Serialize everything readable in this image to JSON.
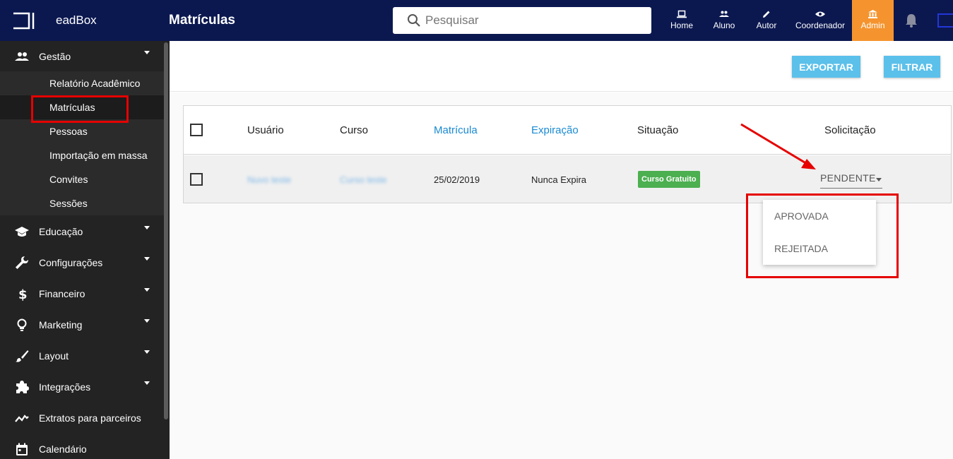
{
  "header": {
    "brand": "eadBox",
    "page_title": "Matrículas",
    "search_placeholder": "Pesquisar",
    "nav": [
      {
        "label": "Home",
        "icon": "laptop-icon"
      },
      {
        "label": "Aluno",
        "icon": "people-icon"
      },
      {
        "label": "Autor",
        "icon": "pencil-icon"
      },
      {
        "label": "Coordenador",
        "icon": "eye-icon"
      },
      {
        "label": "Admin",
        "icon": "bank-icon",
        "active": true
      }
    ],
    "accent_color": "#f5942e",
    "bar_color": "#0b1850"
  },
  "sidebar": {
    "gestao": {
      "label": "Gestão",
      "items": [
        "Relatório Acadêmico",
        "Matrículas",
        "Pessoas",
        "Importação em massa",
        "Convites",
        "Sessões"
      ]
    },
    "sections": [
      {
        "label": "Educação",
        "icon": "graduation-cap-icon"
      },
      {
        "label": "Configurações",
        "icon": "wrench-icon"
      },
      {
        "label": "Financeiro",
        "icon": "dollar-icon"
      },
      {
        "label": "Marketing",
        "icon": "lightbulb-icon"
      },
      {
        "label": "Layout",
        "icon": "brush-icon"
      },
      {
        "label": "Integrações",
        "icon": "puzzle-icon"
      },
      {
        "label": "Extratos para parceiros",
        "icon": "trending-icon"
      },
      {
        "label": "Calendário",
        "icon": "calendar-icon"
      }
    ]
  },
  "toolbar": {
    "export_label": "EXPORTAR",
    "filter_label": "FILTRAR"
  },
  "table": {
    "columns": [
      "Usuário",
      "Curso",
      "Matrícula",
      "Expiração",
      "Situação",
      "Solicitação"
    ],
    "rows": [
      {
        "user": "Nuvo teste",
        "course": "Curso teste",
        "enrollment": "25/02/2019",
        "expiration": "Nunca Expira",
        "status": "Curso Gratuito",
        "request": "PENDENTE"
      }
    ]
  },
  "request_dropdown": {
    "options": [
      "APROVADA",
      "REJEITADA"
    ]
  }
}
